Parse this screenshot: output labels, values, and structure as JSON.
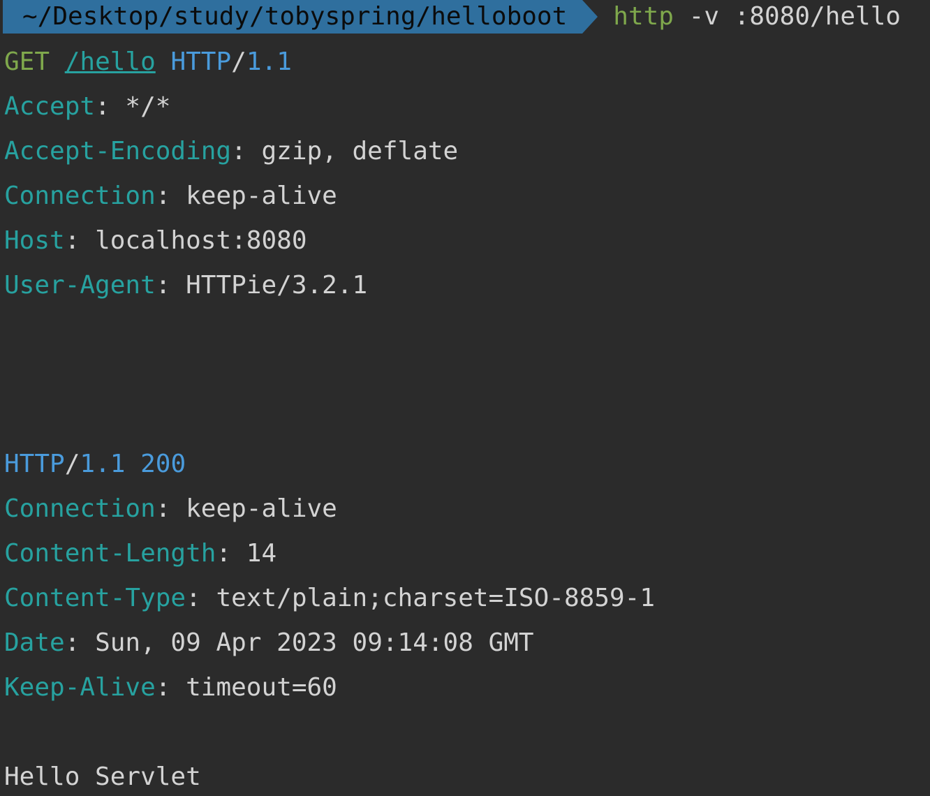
{
  "prompt": {
    "cwd": "~/Desktop/study/tobyspring/helloboot",
    "command": "http",
    "args": " -v :8080/hello"
  },
  "request": {
    "method": "GET",
    "path": "/hello",
    "protocol": "HTTP",
    "version": "/1.1",
    "headers": [
      {
        "name": "Accept",
        "value": "*/*"
      },
      {
        "name": "Accept-Encoding",
        "value": "gzip, deflate"
      },
      {
        "name": "Connection",
        "value": "keep-alive"
      },
      {
        "name": "Host",
        "value": "localhost:8080"
      },
      {
        "name": "User-Agent",
        "value": "HTTPie/3.2.1"
      }
    ]
  },
  "response": {
    "protocol": "HTTP",
    "version": "/1.1",
    "status": "200",
    "headers": [
      {
        "name": "Connection",
        "value": "keep-alive"
      },
      {
        "name": "Content-Length",
        "value": "14"
      },
      {
        "name": "Content-Type",
        "value": "text/plain;charset=ISO-8859-1"
      },
      {
        "name": "Date",
        "value": "Sun, 09 Apr 2023 09:14:08 GMT"
      },
      {
        "name": "Keep-Alive",
        "value": "timeout=60"
      }
    ],
    "body": "Hello Servlet"
  },
  "colors": {
    "background": "#2b2b2b",
    "prompt_segment": "#2f6f9e",
    "command": "#7fa84c",
    "method": "#7fa84c",
    "header_name": "#27a2a0",
    "protocol": "#4a9bdc",
    "text": "#d3d3d3"
  }
}
